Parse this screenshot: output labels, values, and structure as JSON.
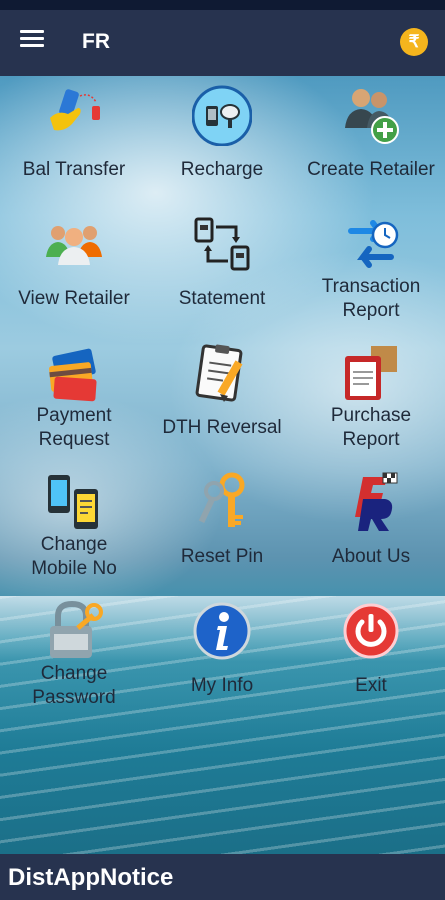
{
  "header": {
    "title": "FR",
    "wallet_symbol": "₹"
  },
  "tiles": [
    {
      "label": "Bal Transfer",
      "icon": "hand-phone-transfer-icon"
    },
    {
      "label": "Recharge",
      "icon": "mobile-dish-icon"
    },
    {
      "label": "Create Retailer",
      "icon": "add-user-icon"
    },
    {
      "label": "View Retailer",
      "icon": "group-icon"
    },
    {
      "label": "Statement",
      "icon": "statement-icon"
    },
    {
      "label_line1": "Transaction",
      "label_line2": "Report",
      "icon": "transaction-history-icon"
    },
    {
      "label_line1": "Payment",
      "label_line2": "Request",
      "icon": "credit-card-icon"
    },
    {
      "label": "DTH Reversal",
      "icon": "clipboard-pencil-icon"
    },
    {
      "label_line1": "Purchase",
      "label_line2": "Report",
      "icon": "purchase-report-icon"
    },
    {
      "label_line1": "Change",
      "label_line2": "Mobile No",
      "icon": "change-mobile-icon"
    },
    {
      "label": "Reset Pin",
      "icon": "keys-icon"
    },
    {
      "label": "About Us",
      "icon": "fr-logo-icon"
    },
    {
      "label_line1": "Change",
      "label_line2": "Password",
      "icon": "lock-key-icon"
    },
    {
      "label": "My Info",
      "icon": "info-icon"
    },
    {
      "label": "Exit",
      "icon": "power-icon"
    }
  ],
  "footer": {
    "text": "DistAppNotice"
  },
  "colors": {
    "app_bar": "#27334f",
    "wallet": "#f5b51d",
    "label": "#1f2a3a"
  }
}
